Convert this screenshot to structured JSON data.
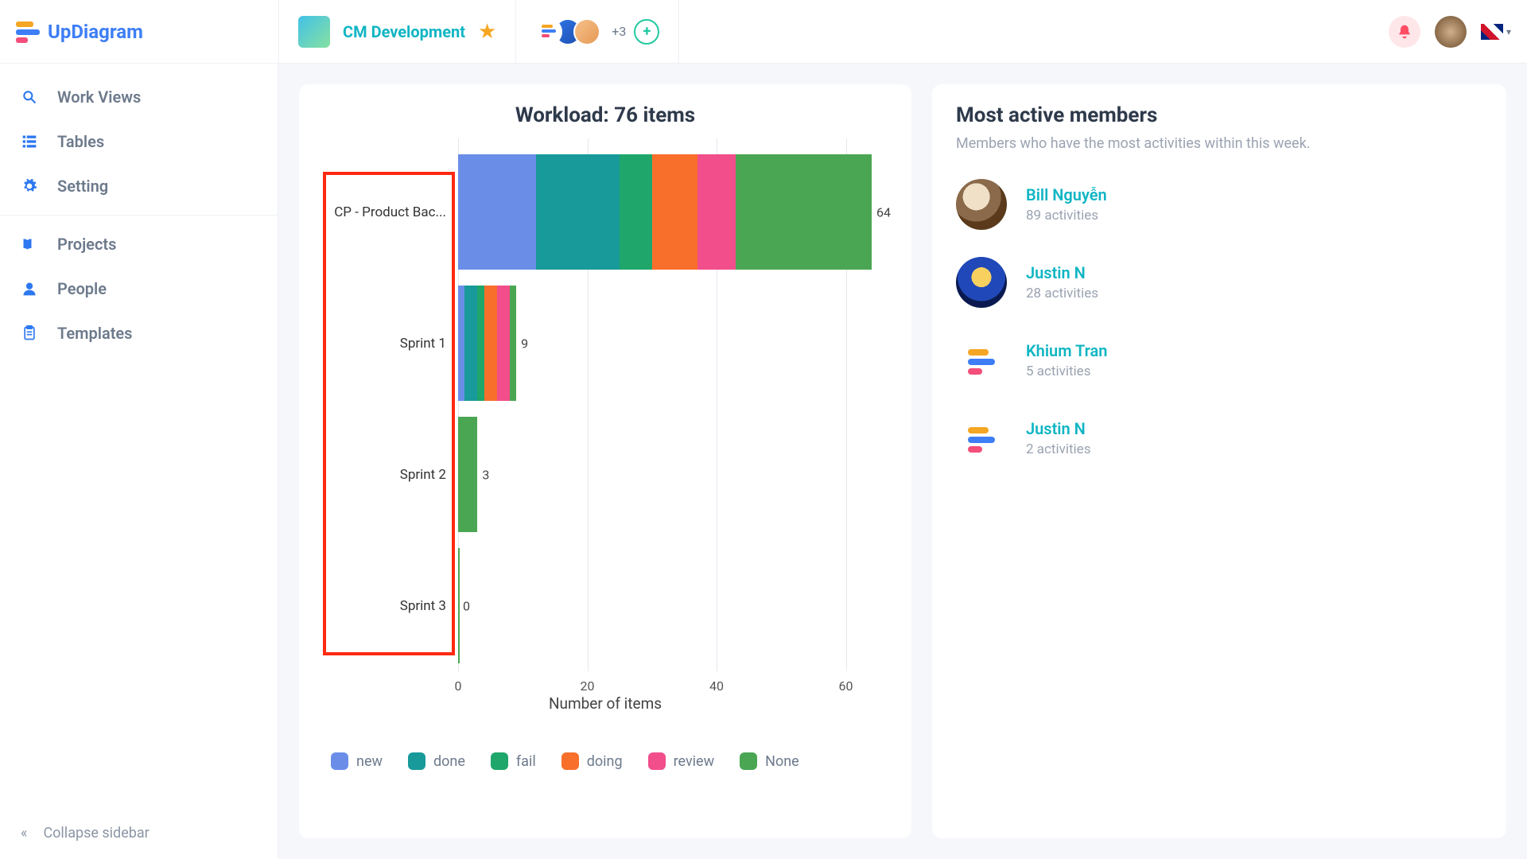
{
  "brand": "UpDiagram",
  "project_name": "CM Development",
  "members_overflow": "+3",
  "sidebar": {
    "items": [
      {
        "label": "Work Views",
        "icon": "search"
      },
      {
        "label": "Tables",
        "icon": "tables"
      },
      {
        "label": "Setting",
        "icon": "gear"
      }
    ],
    "secondary": [
      {
        "label": "Projects",
        "icon": "book"
      },
      {
        "label": "People",
        "icon": "person"
      },
      {
        "label": "Templates",
        "icon": "clipboard"
      }
    ],
    "collapse_label": "Collapse sidebar"
  },
  "chart_data": {
    "type": "bar",
    "title": "Workload: 76 items",
    "xlabel": "Number of items",
    "xlim": [
      0,
      64
    ],
    "xticks": [
      0,
      20,
      40,
      60
    ],
    "categories": [
      "CP - Product Bac...",
      "Sprint 1",
      "Sprint 2",
      "Sprint 3"
    ],
    "series": [
      {
        "name": "new",
        "color": "#6a8ee8",
        "values": [
          12,
          1,
          0,
          0
        ]
      },
      {
        "name": "done",
        "color": "#189a9a",
        "values": [
          13,
          2,
          0,
          0
        ]
      },
      {
        "name": "fail",
        "color": "#1fa66b",
        "values": [
          5,
          1,
          0,
          0
        ]
      },
      {
        "name": "doing",
        "color": "#f86f2b",
        "values": [
          7,
          2,
          0,
          0
        ]
      },
      {
        "name": "review",
        "color": "#f24e8b",
        "values": [
          6,
          2,
          0,
          0
        ]
      },
      {
        "name": "None",
        "color": "#4aa653",
        "values": [
          21,
          1,
          3,
          0
        ]
      }
    ],
    "totals": [
      "64",
      "9",
      "3",
      "0"
    ]
  },
  "active_members": {
    "title": "Most active members",
    "subtitle": "Members who have the most activities within this week.",
    "list": [
      {
        "name": "Bill Nguyễn",
        "activities": "89 activities",
        "avatar": "photo1"
      },
      {
        "name": "Justin N",
        "activities": "28 activities",
        "avatar": "photo2"
      },
      {
        "name": "Khium Tran",
        "activities": "5 activities",
        "avatar": "logo"
      },
      {
        "name": "Justin N",
        "activities": "2 activities",
        "avatar": "logo"
      }
    ]
  }
}
